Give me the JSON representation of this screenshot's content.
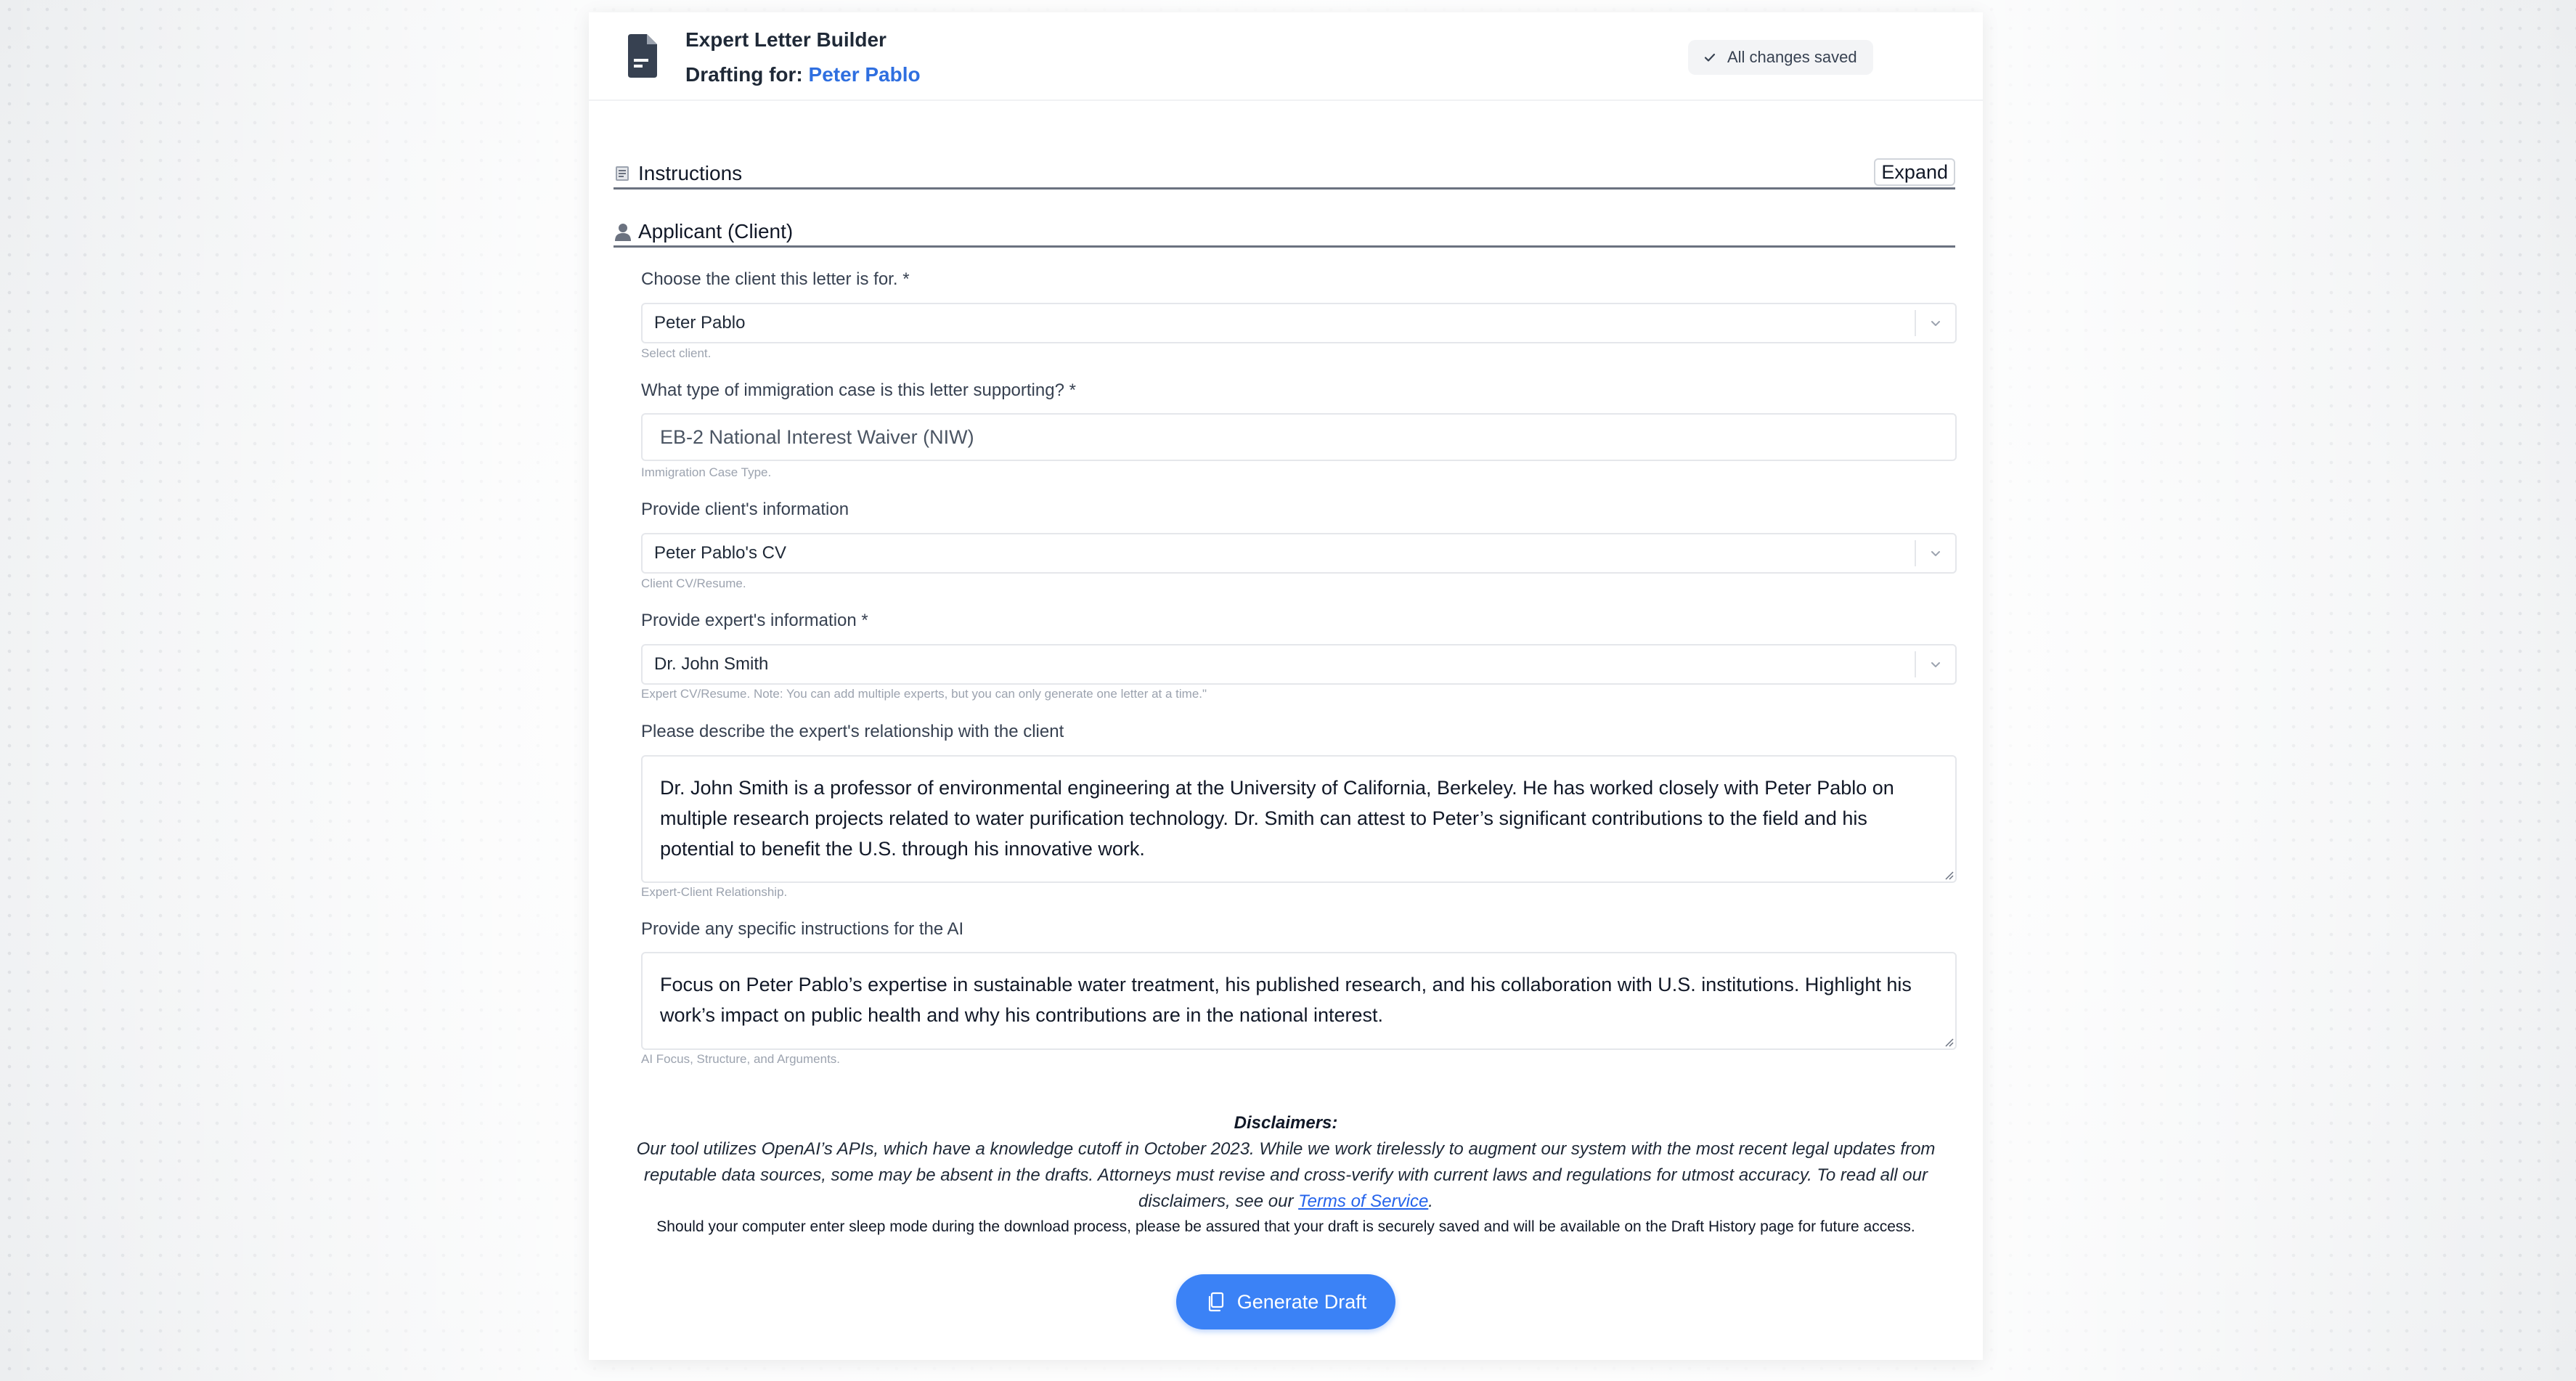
{
  "header": {
    "title": "Expert Letter Builder",
    "drafting_prefix": "Drafting for:",
    "client_name": "Peter Pablo",
    "save_status": "All changes saved"
  },
  "sections": {
    "instructions": {
      "icon": "scroll-icon",
      "label": "Instructions",
      "expand_label": "Expand"
    },
    "applicant": {
      "icon": "person-icon",
      "label": "Applicant (Client)"
    }
  },
  "form": {
    "client": {
      "label": "Choose the client this letter is for.",
      "required_mark": "*",
      "value": "Peter Pablo",
      "help": "Select client."
    },
    "case_type": {
      "label": "What type of immigration case is this letter supporting?",
      "required_mark": "*",
      "value": "EB-2 National Interest Waiver (NIW)",
      "help": "Immigration Case Type."
    },
    "client_info": {
      "label": "Provide client's information",
      "value": "Peter Pablo's CV",
      "help": "Client CV/Resume."
    },
    "expert_info": {
      "label": "Provide expert's information",
      "required_mark": "*",
      "value": "Dr. John Smith",
      "help": "Expert CV/Resume. Note: You can add multiple experts, but you can only generate one letter at a time.\""
    },
    "relationship": {
      "label": "Please describe the expert's relationship with the client",
      "value": "Dr. John Smith is a professor of environmental engineering at the University of California, Berkeley. He has worked closely with Peter Pablo on multiple research projects related to water purification technology. Dr. Smith can attest to Peter’s significant contributions to the field and his potential to benefit the U.S. through his innovative work.",
      "help": "Expert-Client Relationship."
    },
    "ai_instructions": {
      "label": "Provide any specific instructions for the AI",
      "value": "Focus on Peter Pablo’s expertise in sustainable water treatment, his published research, and his collaboration with U.S. institutions. Highlight his work’s impact on public health and why his contributions are in the national interest.",
      "help": "AI Focus, Structure, and Arguments."
    }
  },
  "disclaimers": {
    "title": "Disclaimers:",
    "body": "Our tool utilizes OpenAI’s APIs, which have a knowledge cutoff in October 2023. While we work tirelessly to augment our system with the most recent legal updates from reputable data sources, some may be absent in the drafts. Attorneys must revise and cross-verify with current laws and regulations for utmost accuracy. To read all our disclaimers, see our",
    "link_text": "Terms of Service",
    "body_end": ".",
    "note": "Should your computer enter sleep mode during the download process, please be assured that your draft is securely saved and will be available on the Draft History page for future access."
  },
  "actions": {
    "generate_label": "Generate Draft"
  },
  "colors": {
    "accent": "#3b82f6",
    "client_link": "#2f6fe0"
  }
}
